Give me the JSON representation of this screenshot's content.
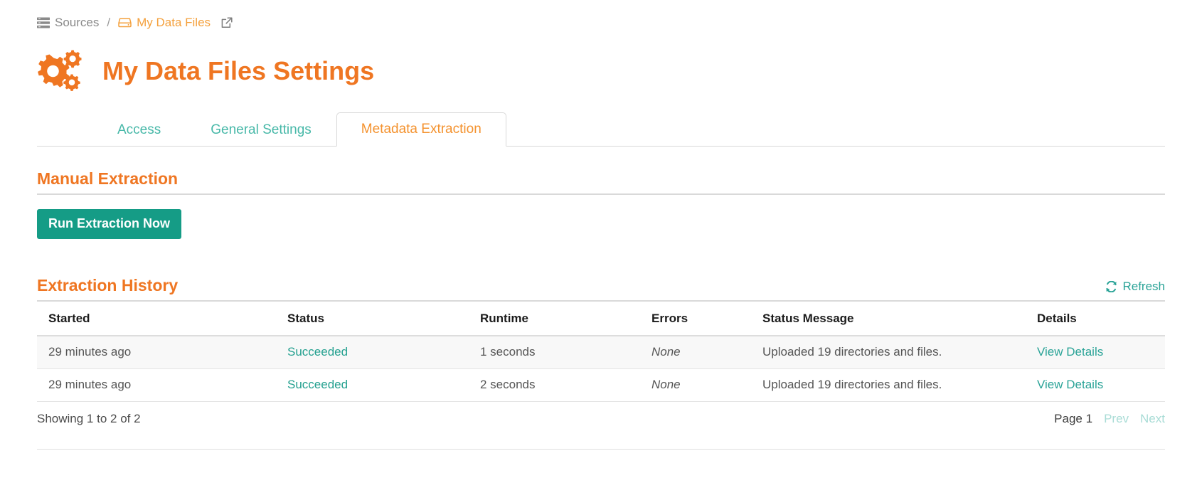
{
  "breadcrumb": {
    "sources_label": "Sources",
    "separator": "/",
    "datafiles_label": "My Data Files",
    "sources_icon": "server-stack-icon",
    "datafiles_icon": "hard-drive-icon",
    "external_icon": "external-link-icon"
  },
  "header": {
    "title": "My Data Files Settings",
    "logo_icon": "gears-icon",
    "accent_color": "#ef7622"
  },
  "tabs": [
    {
      "label": "Access",
      "active": false
    },
    {
      "label": "General Settings",
      "active": false
    },
    {
      "label": "Metadata Extraction",
      "active": true
    }
  ],
  "manual_extraction": {
    "title": "Manual Extraction",
    "run_button_label": "Run Extraction Now",
    "run_button_color": "#159c86"
  },
  "extraction_history": {
    "title": "Extraction History",
    "refresh_label": "Refresh",
    "refresh_icon": "refresh-icon",
    "refresh_color": "#2aa397",
    "columns": [
      "Started",
      "Status",
      "Runtime",
      "Errors",
      "Status Message",
      "Details"
    ],
    "rows": [
      {
        "started": "29 minutes ago",
        "status": "Succeeded",
        "runtime": "1 seconds",
        "errors": "None",
        "message": "Uploaded 19 directories and files.",
        "details": "View Details"
      },
      {
        "started": "29 minutes ago",
        "status": "Succeeded",
        "runtime": "2 seconds",
        "errors": "None",
        "message": "Uploaded 19 directories and files.",
        "details": "View Details"
      }
    ],
    "footer": {
      "showing": "Showing 1 to 2 of 2",
      "page_label": "Page 1",
      "prev_label": "Prev",
      "next_label": "Next"
    }
  }
}
